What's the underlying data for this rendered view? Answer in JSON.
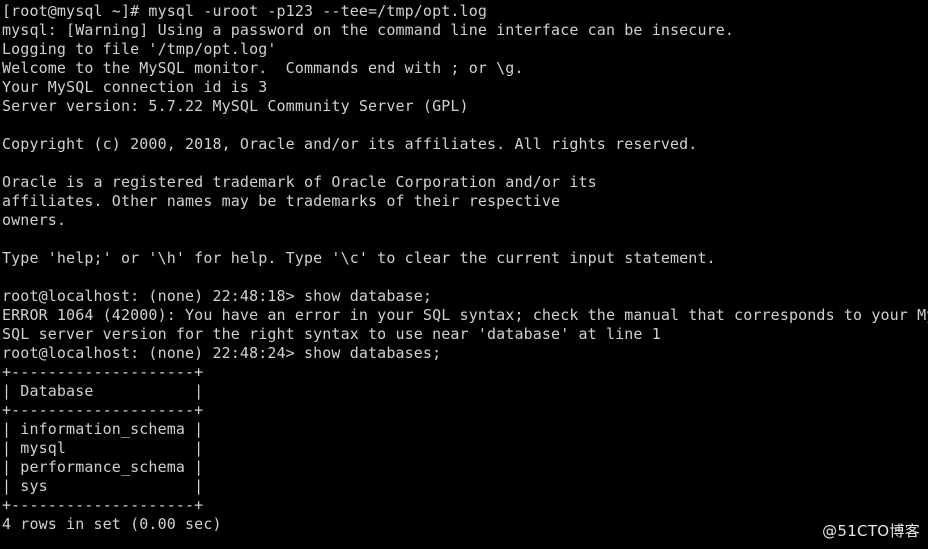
{
  "terminal": {
    "background_color": "#000000",
    "foreground_color": "#d0d0d0",
    "shell_prompt": "[root@mysql ~]#",
    "command": "mysql -uroot -p123 --tee=/tmp/opt.log",
    "lines": [
      "[root@mysql ~]# mysql -uroot -p123 --tee=/tmp/opt.log",
      "mysql: [Warning] Using a password on the command line interface can be insecure.",
      "Logging to file '/tmp/opt.log'",
      "Welcome to the MySQL monitor.  Commands end with ; or \\g.",
      "Your MySQL connection id is 3",
      "Server version: 5.7.22 MySQL Community Server (GPL)",
      "",
      "Copyright (c) 2000, 2018, Oracle and/or its affiliates. All rights reserved.",
      "",
      "Oracle is a registered trademark of Oracle Corporation and/or its",
      "affiliates. Other names may be trademarks of their respective",
      "owners.",
      "",
      "Type 'help;' or '\\h' for help. Type '\\c' to clear the current input statement.",
      "",
      "root@localhost: (none) 22:48:18> show database;",
      "ERROR 1064 (42000): You have an error in your SQL syntax; check the manual that corresponds to your My",
      "SQL server version for the right syntax to use near 'database' at line 1",
      "root@localhost: (none) 22:48:24> show databases;",
      "+--------------------+",
      "| Database           |",
      "+--------------------+",
      "| information_schema |",
      "| mysql              |",
      "| performance_schema |",
      "| sys                |",
      "+--------------------+",
      "4 rows in set (0.00 sec)"
    ]
  },
  "session": {
    "mysql_prompt_user": "root@localhost",
    "mysql_prompt_db": "(none)",
    "prompt_timestamps": [
      "22:48:18",
      "22:48:24"
    ],
    "server_version": "5.7.22",
    "server_edition": "MySQL Community Server (GPL)",
    "connection_id": "3",
    "tee_file": "/tmp/opt.log",
    "copyright": "Copyright (c) 2000, 2018, Oracle and/or its affiliates. All rights reserved."
  },
  "error": {
    "code": "ERROR 1064 (42000)",
    "sqlstate": "42000",
    "number": "1064",
    "near_token": "'database'",
    "line_number": "1"
  },
  "query_result": {
    "table": {
      "border": "+--------------------+",
      "columns": [
        "Database"
      ],
      "rows": [
        [
          "information_schema"
        ],
        [
          "mysql"
        ],
        [
          "performance_schema"
        ],
        [
          "sys"
        ]
      ]
    },
    "status": "4 rows in set (0.00 sec)",
    "row_count": 4,
    "duration": "0.00 sec"
  },
  "watermark": {
    "text": "@51CTO博客"
  }
}
